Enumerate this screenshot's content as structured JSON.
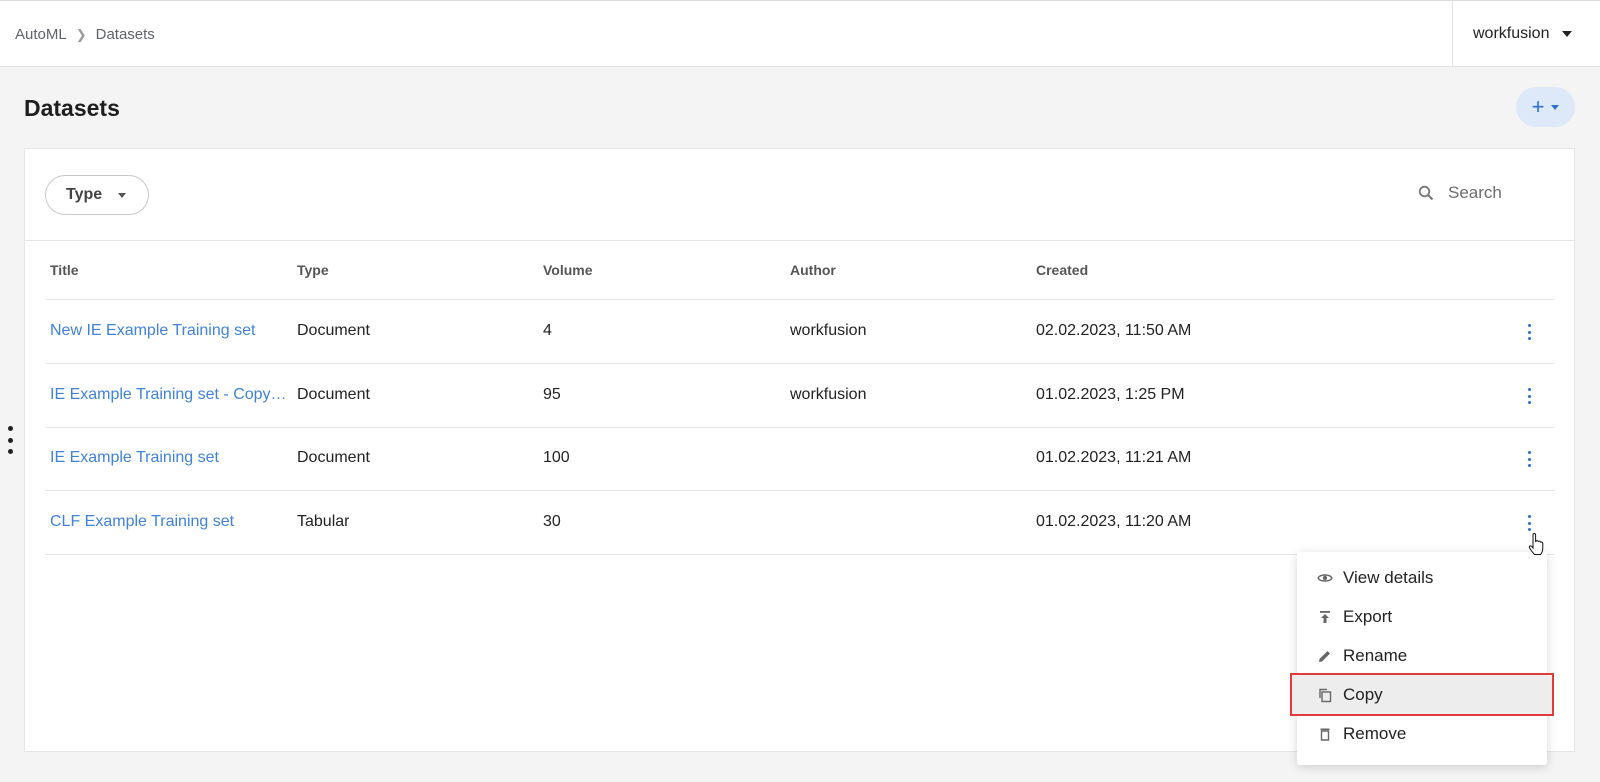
{
  "breadcrumb": {
    "root": "AutoML",
    "current": "Datasets"
  },
  "user": {
    "name": "workfusion"
  },
  "page": {
    "title": "Datasets",
    "add_icon": "plus-icon"
  },
  "filters": {
    "type_label": "Type",
    "search_placeholder": "Search"
  },
  "table": {
    "columns": [
      "Title",
      "Type",
      "Volume",
      "Author",
      "Created"
    ],
    "rows": [
      {
        "title": "New IE Example Training set",
        "type": "Document",
        "volume": "4",
        "author": "workfusion",
        "created": "02.02.2023, 11:50 AM"
      },
      {
        "title": "IE Example Training set - Copy…",
        "type": "Document",
        "volume": "95",
        "author": "workfusion",
        "created": "01.02.2023, 1:25 PM"
      },
      {
        "title": "IE Example Training set",
        "type": "Document",
        "volume": "100",
        "author": "",
        "created": "01.02.2023, 11:21 AM"
      },
      {
        "title": "CLF Example Training set",
        "type": "Tabular",
        "volume": "30",
        "author": "",
        "created": "01.02.2023, 11:20 AM"
      }
    ]
  },
  "context_menu": {
    "items": [
      {
        "label": "View details",
        "icon": "eye-icon"
      },
      {
        "label": "Export",
        "icon": "export-icon"
      },
      {
        "label": "Rename",
        "icon": "pencil-icon"
      },
      {
        "label": "Copy",
        "icon": "copy-icon"
      },
      {
        "label": "Remove",
        "icon": "trash-icon"
      }
    ],
    "highlighted": "Copy"
  },
  "colors": {
    "link": "#3f82d8",
    "accent": "#2f6fd0",
    "highlight_border": "#e03a3a"
  }
}
